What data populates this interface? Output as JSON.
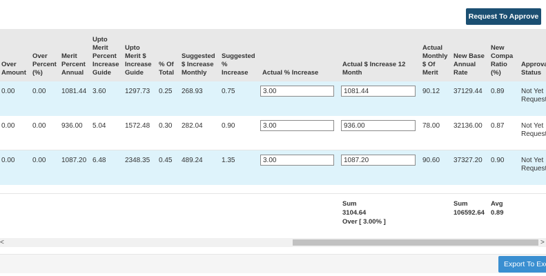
{
  "toolbar": {
    "request_label": "Request To Approve"
  },
  "table": {
    "headers": [
      "Over\nAmount",
      "Over\nPercent\n(%)",
      "Merit\nPercent\nAnnual",
      "Upto\nMerit\nPercent\nIncrease\nGuide",
      "Upto\nMerit $\nIncrease\nGuide",
      "% Of\nTotal",
      "Suggested\n$ Increase\nMonthly",
      "Suggested\n%\nIncrease",
      "Actual % Increase",
      "Actual $ Increase 12\nMonth",
      "Actual\nMonthly\n$ Of\nMerit",
      "New Base\nAnnual\nRate",
      "New\nCompa\nRatio\n(%)",
      "Approval\nStatus"
    ],
    "rows": [
      {
        "over_amount": "0.00",
        "over_percent": "0.00",
        "merit_annual": "1081.44",
        "upto_pct_guide": "3.60",
        "upto_usd_guide": "1297.73",
        "pct_total": "0.25",
        "sugg_usd_monthly": "268.93",
        "sugg_pct": "0.75",
        "actual_pct": "3.00",
        "actual_usd_12": "1081.44",
        "actual_monthly": "90.12",
        "new_base": "37129.44",
        "new_compa": "0.89",
        "status": "Not Yet\nRequested"
      },
      {
        "over_amount": "0.00",
        "over_percent": "0.00",
        "merit_annual": "936.00",
        "upto_pct_guide": "5.04",
        "upto_usd_guide": "1572.48",
        "pct_total": "0.30",
        "sugg_usd_monthly": "282.04",
        "sugg_pct": "0.90",
        "actual_pct": "3.00",
        "actual_usd_12": "936.00",
        "actual_monthly": "78.00",
        "new_base": "32136.00",
        "new_compa": "0.87",
        "status": "Not Yet\nRequested"
      },
      {
        "over_amount": "0.00",
        "over_percent": "0.00",
        "merit_annual": "1087.20",
        "upto_pct_guide": "6.48",
        "upto_usd_guide": "2348.35",
        "pct_total": "0.45",
        "sugg_usd_monthly": "489.24",
        "sugg_pct": "1.35",
        "actual_pct": "3.00",
        "actual_usd_12": "1087.20",
        "actual_monthly": "90.60",
        "new_base": "37327.20",
        "new_compa": "0.90",
        "status": "Not Yet\nRequested"
      }
    ],
    "summary": {
      "actual_usd": "Sum\n3104.64\nOver [ 3.00% ]",
      "new_base": "Sum\n106592.64",
      "new_compa": "Avg\n0.89"
    }
  },
  "scroll": {
    "left_arrow": "<",
    "right_arrow": ">"
  },
  "footer": {
    "export_label": "Export To Excel"
  },
  "colors": {
    "primary_button": "#1b4f72",
    "export_button": "#3a8fd1",
    "row_highlight": "#def3fb",
    "header_bg": "#e8e8e8"
  }
}
